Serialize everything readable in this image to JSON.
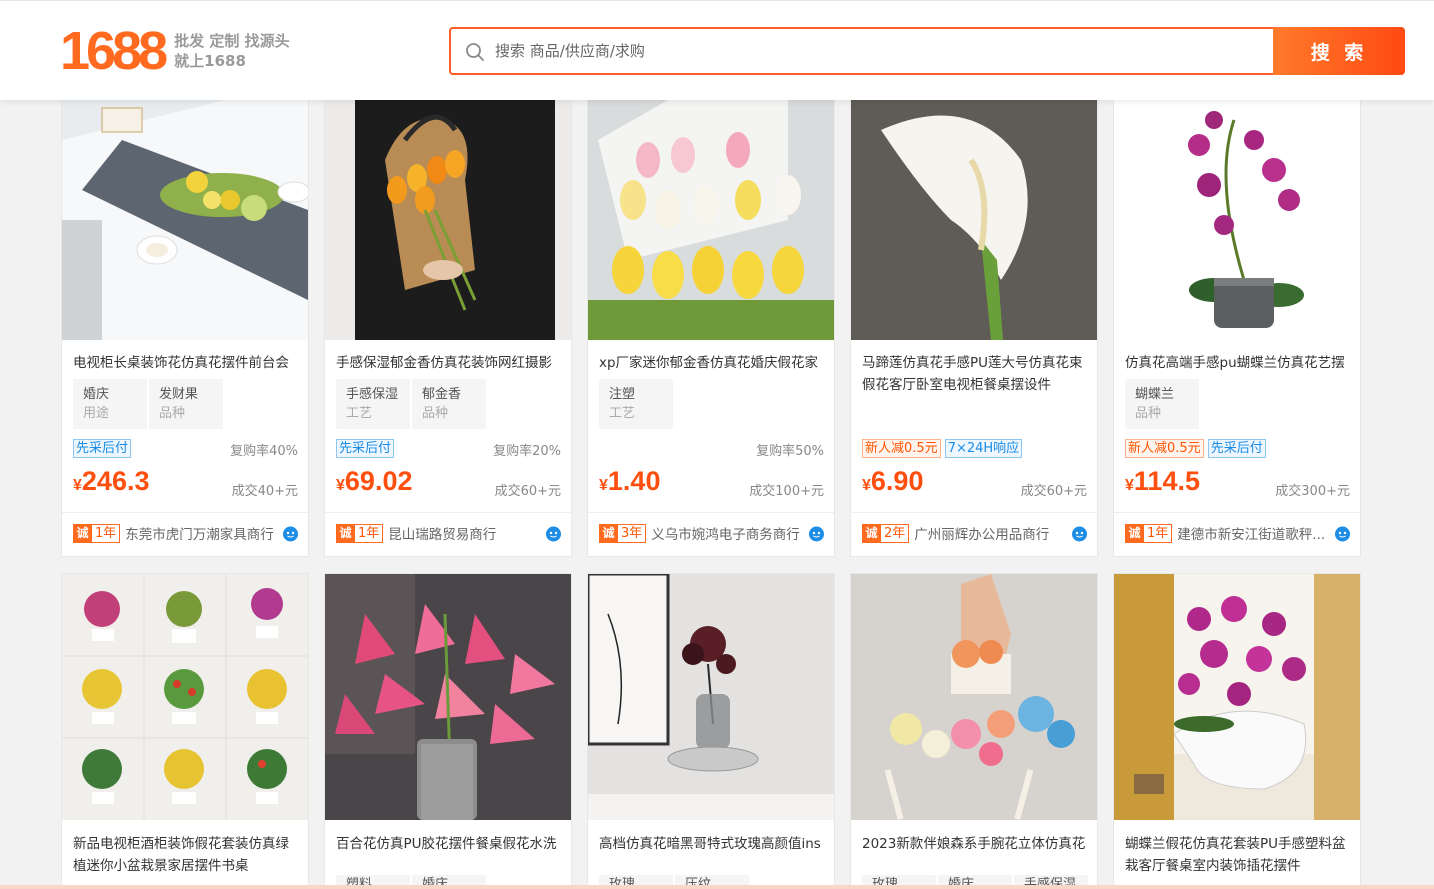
{
  "header": {
    "logo_text": "1688",
    "slogan_line1": "批发 定制 找源头",
    "slogan_line2": "就上1688",
    "search_placeholder": "搜索 商品/供应商/求购",
    "search_button": "搜 索"
  },
  "colors": {
    "accent": "#ff6a1f",
    "price": "#ff4f0f",
    "blue_badge": "#1a8ce6"
  },
  "products": [
    {
      "title": "电视柜长桌装饰花仿真花摆件前台会",
      "tags": [
        {
          "value": "婚庆",
          "key": "用途"
        },
        {
          "value": "发财果",
          "key": "品种"
        }
      ],
      "badges": [
        {
          "text": "先采后付",
          "style": "blue"
        }
      ],
      "rebuy": "复购率40%",
      "currency": "¥",
      "price": "246.3",
      "deal": "成交40+元",
      "shop": {
        "cheng": "诚",
        "years": "1年",
        "name": "东莞市虎门万潮家具商行"
      }
    },
    {
      "title": "手感保湿郁金香仿真花装饰网红摄影",
      "tags": [
        {
          "value": "手感保湿",
          "key": "工艺"
        },
        {
          "value": "郁金香",
          "key": "品种"
        }
      ],
      "badges": [
        {
          "text": "先采后付",
          "style": "blue"
        }
      ],
      "rebuy": "复购率20%",
      "currency": "¥",
      "price": "69.02",
      "deal": "成交60+元",
      "shop": {
        "cheng": "诚",
        "years": "1年",
        "name": "昆山瑞路贸易商行"
      }
    },
    {
      "title": "xp厂家迷你郁金香仿真花婚庆假花家",
      "tags": [
        {
          "value": "注塑",
          "key": "工艺"
        }
      ],
      "badges": [],
      "rebuy": "复购率50%",
      "currency": "¥",
      "price": "1.40",
      "deal": "成交100+元",
      "shop": {
        "cheng": "诚",
        "years": "3年",
        "name": "义乌市婉鸿电子商务商行"
      }
    },
    {
      "title": "马蹄莲仿真花手感PU莲大号仿真花束假花客厅卧室电视柜餐桌摆设件",
      "tags": [],
      "badges": [
        {
          "text": "新人减0.5元",
          "style": "orange"
        },
        {
          "text": "7×24H响应",
          "style": "blue"
        }
      ],
      "rebuy": "",
      "currency": "¥",
      "price": "6.90",
      "deal": "成交60+元",
      "shop": {
        "cheng": "诚",
        "years": "2年",
        "name": "广州丽辉办公用品商行"
      }
    },
    {
      "title": "仿真花高端手感pu蝴蝶兰仿真花艺摆",
      "tags": [
        {
          "value": "蝴蝶兰",
          "key": "品种"
        }
      ],
      "badges": [
        {
          "text": "新人减0.5元",
          "style": "orange"
        },
        {
          "text": "先采后付",
          "style": "blue"
        }
      ],
      "rebuy": "",
      "currency": "¥",
      "price": "114.5",
      "deal": "成交300+元",
      "shop": {
        "cheng": "诚",
        "years": "1年",
        "name": "建德市新安江街道歌秤..."
      }
    },
    {
      "title": "新品电视柜酒柜装饰假花套装仿真绿植迷你小盆栽景家居摆件书桌",
      "tags": [],
      "badges": [],
      "rebuy": "",
      "currency": "",
      "price": "",
      "deal": "",
      "shop": {
        "cheng": "",
        "years": "",
        "name": ""
      }
    },
    {
      "title": "百合花仿真PU胶花摆件餐桌假花水洗",
      "tags": [
        {
          "value": "塑料",
          "key": ""
        },
        {
          "value": "婚庆",
          "key": ""
        }
      ],
      "badges": [],
      "rebuy": "",
      "currency": "",
      "price": "",
      "deal": "",
      "shop": {
        "cheng": "",
        "years": "",
        "name": ""
      }
    },
    {
      "title": "高档仿真花暗黑哥特式玫瑰高颜值ins",
      "tags": [
        {
          "value": "玫瑰",
          "key": ""
        },
        {
          "value": "压纹",
          "key": ""
        }
      ],
      "badges": [],
      "rebuy": "",
      "currency": "",
      "price": "",
      "deal": "",
      "shop": {
        "cheng": "",
        "years": "",
        "name": ""
      }
    },
    {
      "title": "2023新款伴娘森系手腕花立体仿真花",
      "tags": [
        {
          "value": "玫瑰",
          "key": ""
        },
        {
          "value": "婚庆",
          "key": ""
        },
        {
          "value": "手感保湿",
          "key": ""
        }
      ],
      "badges": [],
      "rebuy": "",
      "currency": "",
      "price": "",
      "deal": "",
      "shop": {
        "cheng": "",
        "years": "",
        "name": ""
      }
    },
    {
      "title": "蝴蝶兰假花仿真花套装PU手感塑料盆栽客厅餐桌室内装饰插花摆件",
      "tags": [],
      "badges": [],
      "rebuy": "",
      "currency": "",
      "price": "",
      "deal": "",
      "shop": {
        "cheng": "",
        "years": "",
        "name": ""
      }
    }
  ]
}
